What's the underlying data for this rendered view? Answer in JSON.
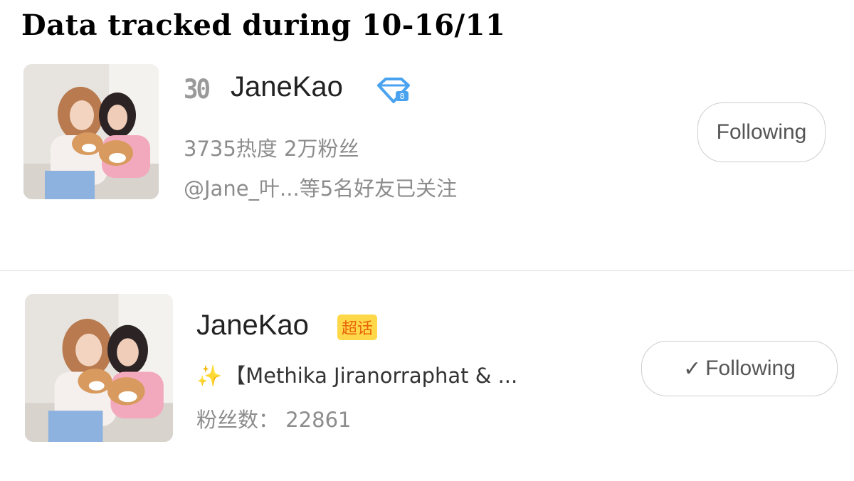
{
  "heading": "Data tracked during 10-16/11",
  "card1": {
    "rank": "30",
    "name": "JaneKao",
    "badge_icon": "diamond-vip-icon",
    "stats": "3735热度 2万粉丝",
    "friends": "@Jane_叶...等5名好友已关注",
    "follow_label": "Following"
  },
  "card2": {
    "name": "JaneKao",
    "topic_badge": "超话",
    "sparkle": "✨",
    "description": "【Methika Jiranorraphat & ...",
    "fans": "粉丝数： 22861",
    "follow_check": "✓",
    "follow_label": "Following"
  },
  "colors": {
    "badge_bg": "#ffd84a",
    "badge_text": "#e8640a",
    "vip_icon": "#4aa3f0",
    "meta_text": "#8c8c8c"
  }
}
